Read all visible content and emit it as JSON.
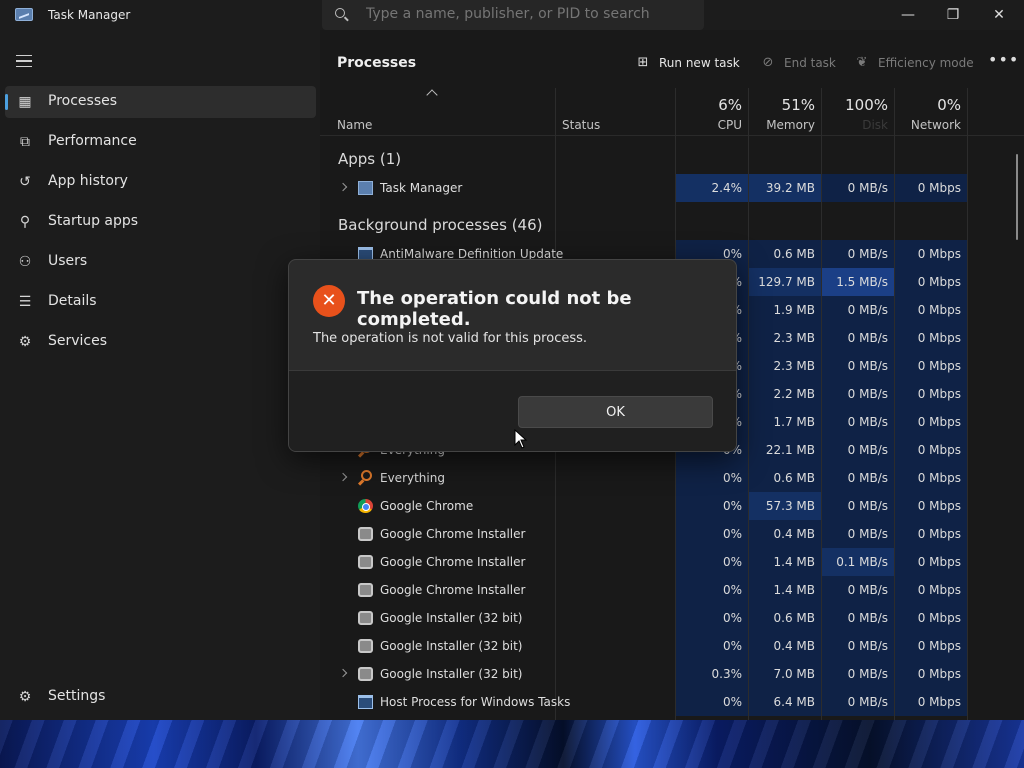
{
  "window": {
    "title": "Task Manager",
    "search_placeholder": "Type a name, publisher, or PID to search",
    "controls": {
      "minimize": "—",
      "maximize": "❐",
      "close": "✕"
    }
  },
  "sidebar": {
    "items": [
      {
        "label": "Processes",
        "icon": "processes-icon",
        "active": true
      },
      {
        "label": "Performance",
        "icon": "performance-icon"
      },
      {
        "label": "App history",
        "icon": "history-icon"
      },
      {
        "label": "Startup apps",
        "icon": "startup-icon"
      },
      {
        "label": "Users",
        "icon": "users-icon"
      },
      {
        "label": "Details",
        "icon": "details-icon"
      },
      {
        "label": "Services",
        "icon": "services-icon"
      }
    ],
    "settings_label": "Settings"
  },
  "main": {
    "title": "Processes",
    "toolbar": {
      "run_new_task": "Run new task",
      "end_task": "End task",
      "efficiency_mode": "Efficiency mode",
      "more": "•••"
    },
    "columns": {
      "name": "Name",
      "status": "Status",
      "cpu": {
        "pct": "6%",
        "label": "CPU"
      },
      "memory": {
        "pct": "51%",
        "label": "Memory"
      },
      "disk": {
        "pct": "100%",
        "label": "Disk"
      },
      "network": {
        "pct": "0%",
        "label": "Network"
      }
    },
    "groups": {
      "apps": "Apps (1)",
      "background": "Background processes (46)"
    },
    "rows": [
      {
        "name": "Task Manager",
        "cpu": "2.4%",
        "mem": "39.2 MB",
        "disk": "0 MB/s",
        "net": "0 Mbps"
      },
      {
        "name": "AntiMalware Definition Update",
        "cpu": "0%",
        "mem": "0.6 MB",
        "disk": "0 MB/s",
        "net": "0 Mbps"
      },
      {
        "name": "",
        "cpu": "%",
        "mem": "129.7 MB",
        "disk": "1.5 MB/s",
        "net": "0 Mbps"
      },
      {
        "name": "",
        "cpu": "%",
        "mem": "1.9 MB",
        "disk": "0 MB/s",
        "net": "0 Mbps"
      },
      {
        "name": "",
        "cpu": "%",
        "mem": "2.3 MB",
        "disk": "0 MB/s",
        "net": "0 Mbps"
      },
      {
        "name": "",
        "cpu": "%",
        "mem": "2.3 MB",
        "disk": "0 MB/s",
        "net": "0 Mbps"
      },
      {
        "name": "",
        "cpu": "%",
        "mem": "2.2 MB",
        "disk": "0 MB/s",
        "net": "0 Mbps"
      },
      {
        "name": "",
        "cpu": "%",
        "mem": "1.7 MB",
        "disk": "0 MB/s",
        "net": "0 Mbps"
      },
      {
        "name": "Everything",
        "cpu": "0%",
        "mem": "22.1 MB",
        "disk": "0 MB/s",
        "net": "0 Mbps"
      },
      {
        "name": "Everything",
        "cpu": "0%",
        "mem": "0.6 MB",
        "disk": "0 MB/s",
        "net": "0 Mbps"
      },
      {
        "name": "Google Chrome",
        "cpu": "0%",
        "mem": "57.3 MB",
        "disk": "0 MB/s",
        "net": "0 Mbps"
      },
      {
        "name": "Google Chrome Installer",
        "cpu": "0%",
        "mem": "0.4 MB",
        "disk": "0 MB/s",
        "net": "0 Mbps"
      },
      {
        "name": "Google Chrome Installer",
        "cpu": "0%",
        "mem": "1.4 MB",
        "disk": "0.1 MB/s",
        "net": "0 Mbps"
      },
      {
        "name": "Google Chrome Installer",
        "cpu": "0%",
        "mem": "1.4 MB",
        "disk": "0 MB/s",
        "net": "0 Mbps"
      },
      {
        "name": "Google Installer (32 bit)",
        "cpu": "0%",
        "mem": "0.6 MB",
        "disk": "0 MB/s",
        "net": "0 Mbps"
      },
      {
        "name": "Google Installer (32 bit)",
        "cpu": "0%",
        "mem": "0.4 MB",
        "disk": "0 MB/s",
        "net": "0 Mbps"
      },
      {
        "name": "Google Installer (32 bit)",
        "cpu": "0.3%",
        "mem": "7.0 MB",
        "disk": "0 MB/s",
        "net": "0 Mbps"
      },
      {
        "name": "Host Process for Windows Tasks",
        "cpu": "0%",
        "mem": "6.4 MB",
        "disk": "0 MB/s",
        "net": "0 Mbps"
      }
    ]
  },
  "dialog": {
    "title": "The operation could not be completed.",
    "message": "The operation is not valid for this process.",
    "ok_label": "OK",
    "icon": "error-icon",
    "accent_color": "#e8511b"
  }
}
